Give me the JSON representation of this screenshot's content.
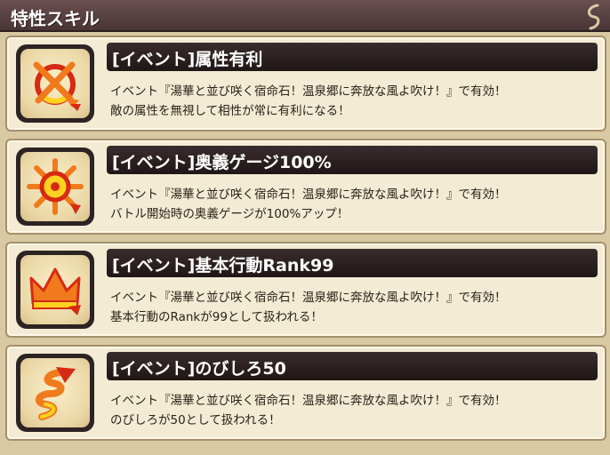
{
  "header": {
    "title": "特性スキル"
  },
  "skills": [
    {
      "title": "[イベント]属性有利",
      "line1": "イベント『湯華と並び咲く宿命石！温泉郷に奔放な風よ吹け！』で有効！",
      "line2": "敵の属性を無視して相性が常に有利になる！",
      "icon": "target-arrow-icon"
    },
    {
      "title": "[イベント]奥義ゲージ100%",
      "line1": "イベント『湯華と並び咲く宿命石！温泉郷に奔放な風よ吹け！』で有効！",
      "line2": "バトル開始時の奥義ゲージが100%アップ！",
      "icon": "sun-emblem-arrow-icon"
    },
    {
      "title": "[イベント]基本行動Rank99",
      "line1": "イベント『湯華と並び咲く宿命石！温泉郷に奔放な風よ吹け！』で有効！",
      "line2": "基本行動のRankが99として扱われる！",
      "icon": "crown-arrow-icon"
    },
    {
      "title": "[イベント]のびしろ50",
      "line1": "イベント『湯華と並び咲く宿命石！温泉郷に奔放な風よ吹け！』で有効！",
      "line2": "のびしろが50として扱われる！",
      "icon": "spiral-arrow-icon"
    }
  ],
  "colors": {
    "header_bg": "#5a4242",
    "card_bg": "#f3ebd4",
    "title_bar_bg": "#2a1f1f",
    "icon_orange": "#f07a1c",
    "icon_red": "#d62a12",
    "icon_yellow": "#ffd21f"
  }
}
